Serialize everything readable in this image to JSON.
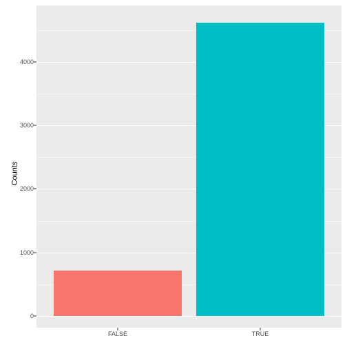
{
  "chart_data": {
    "type": "bar",
    "categories": [
      "FALSE",
      "TRUE"
    ],
    "values": [
      720,
      4620
    ],
    "colors": [
      "#f8766d",
      "#00bfc4"
    ],
    "ylabel": "Counts",
    "xlabel": "",
    "ylim": [
      0,
      4800
    ],
    "yticks": [
      0,
      1000,
      2000,
      3000,
      4000
    ]
  }
}
